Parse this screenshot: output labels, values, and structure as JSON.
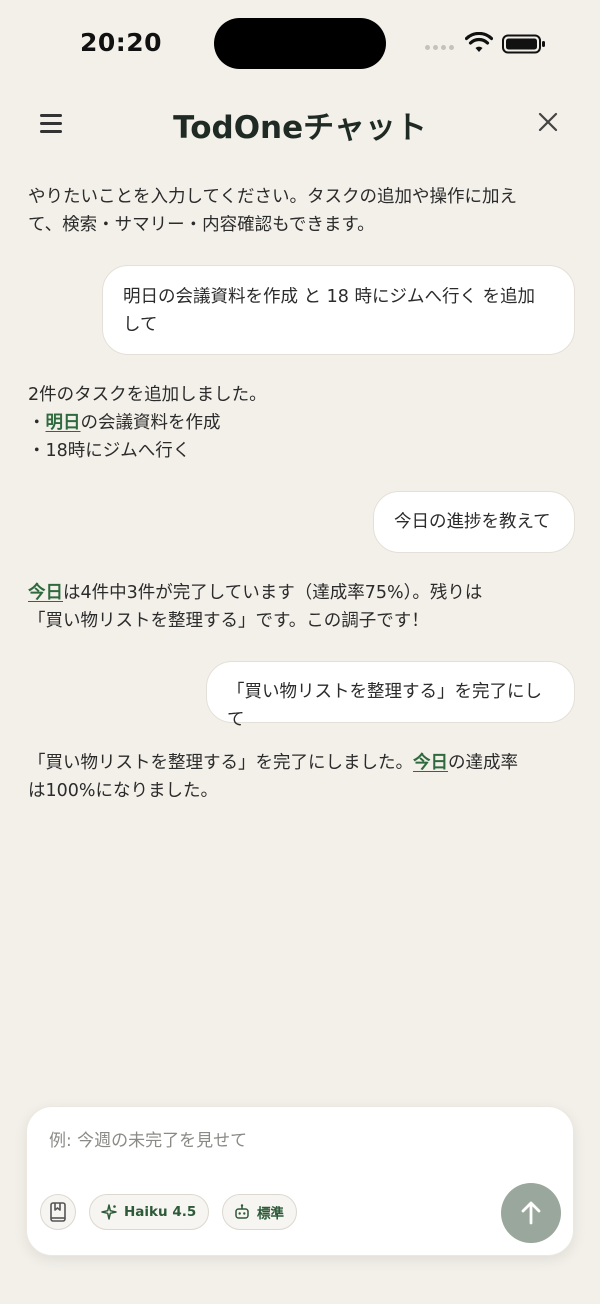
{
  "status": {
    "time": "20:20"
  },
  "header": {
    "title": "TodOneチャット"
  },
  "messages": {
    "intro": {
      "line1": "やりたいことを入力してください。タスクの追加や操作に加え",
      "line2": "て、検索・サマリー・内容確認もできます。"
    },
    "user1": {
      "line1": "明日の会議資料を作成 と 18 時にジムへ行く を追加",
      "line2": "して"
    },
    "bot1": {
      "line1": "2件のタスクを追加しました。",
      "line2_prefix": "・",
      "line2_link": "明日",
      "line2_rest": "の会議資料を作成",
      "line3": "・18時にジムへ行く"
    },
    "user2": {
      "text": "今日の進捗を教えて"
    },
    "bot2": {
      "line1_link": "今日",
      "line1_rest": "は4件中3件が完了しています（達成率75%）。残りは",
      "line2": "「買い物リストを整理する」です。この調子です！"
    },
    "user3": {
      "text": "「買い物リストを整理する」を完了にして"
    },
    "bot3": {
      "line1_pre": "「買い物リストを整理する」を完了にしました。",
      "line1_link": "今日",
      "line1_post": "の達成率",
      "line2": "は100%になりました。"
    }
  },
  "composer": {
    "placeholder": "例: 今週の未完了を見せて",
    "model_label": "Haiku 4.5",
    "mode_label": "標準"
  },
  "icons": {
    "menu": "hamburger-icon",
    "close": "close-icon",
    "book": "bookmark-book-icon",
    "sparkle": "sparkle-icon",
    "robot": "robot-icon",
    "send": "arrow-up-icon"
  },
  "colors": {
    "background": "#f3f0ea",
    "accent": "#2f6a3e",
    "send_button": "#9aa79c"
  }
}
